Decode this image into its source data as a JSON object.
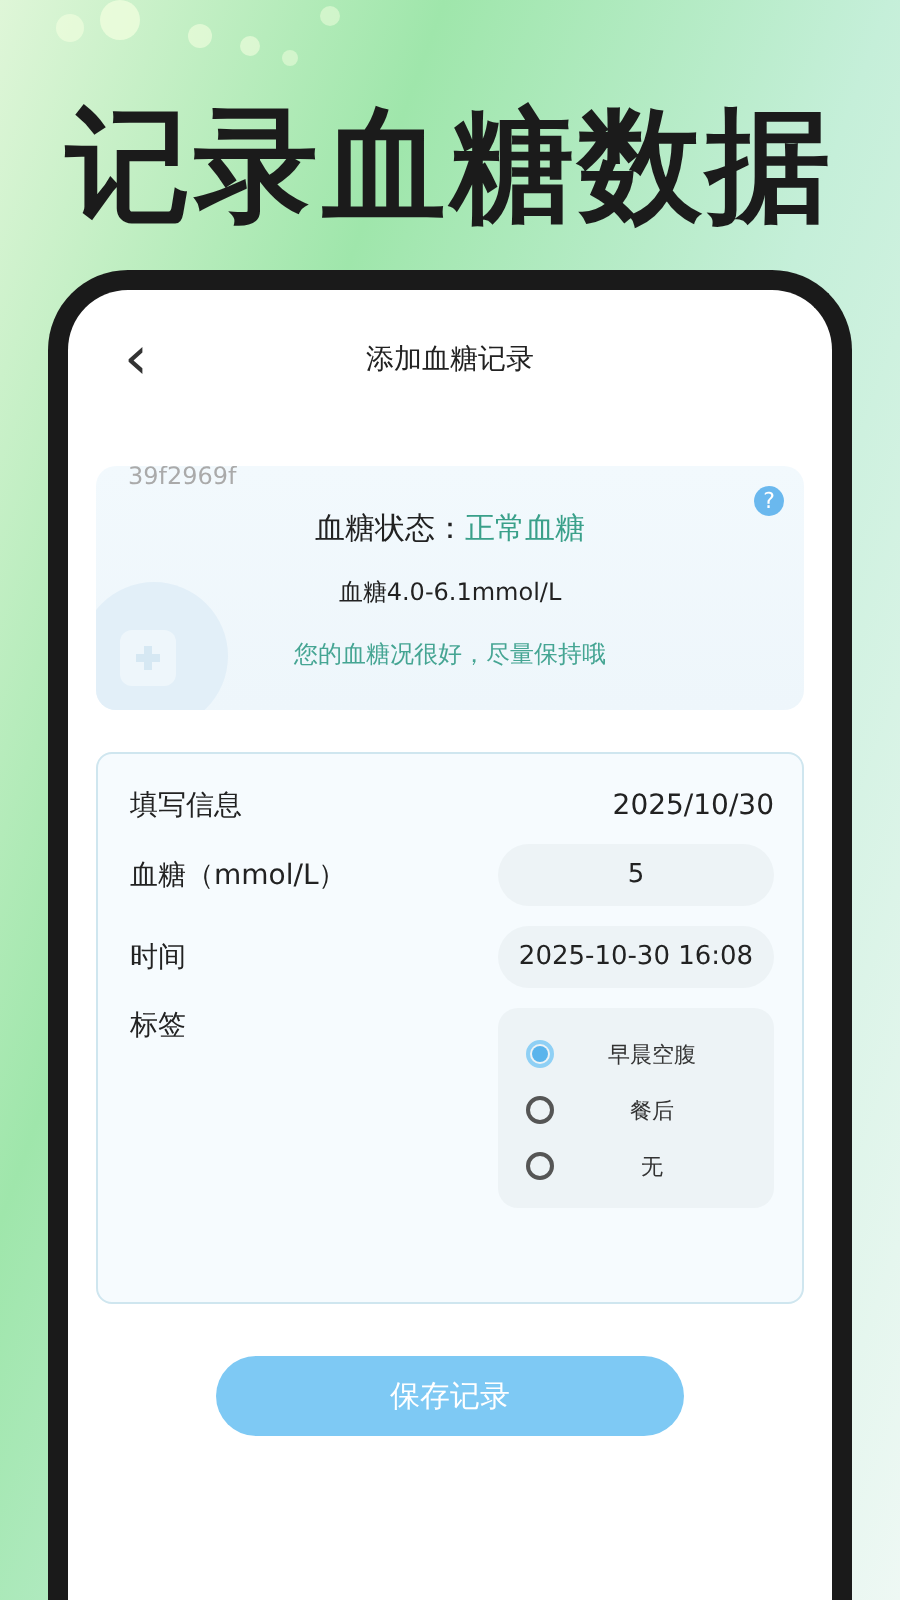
{
  "headline": "记录血糖数据",
  "header": {
    "back": "‹",
    "title": "添加血糖记录"
  },
  "status_card": {
    "code": "39f2969f",
    "help": "?",
    "status_label": "血糖状态：",
    "status_value": "正常血糖",
    "range": "血糖4.0-6.1mmol/L",
    "advice": "您的血糖况很好，尽量保持哦"
  },
  "form": {
    "title": "填写信息",
    "date": "2025/10/30",
    "fields": [
      {
        "label": "血糖（mmol/L）",
        "value": "5"
      },
      {
        "label": "时间",
        "value": "2025-10-30 16:08"
      }
    ],
    "tag_label": "标签",
    "tags": [
      {
        "label": "早晨空腹",
        "selected": true
      },
      {
        "label": "餐后",
        "selected": false
      },
      {
        "label": "无",
        "selected": false
      }
    ]
  },
  "save_button": "保存记录"
}
